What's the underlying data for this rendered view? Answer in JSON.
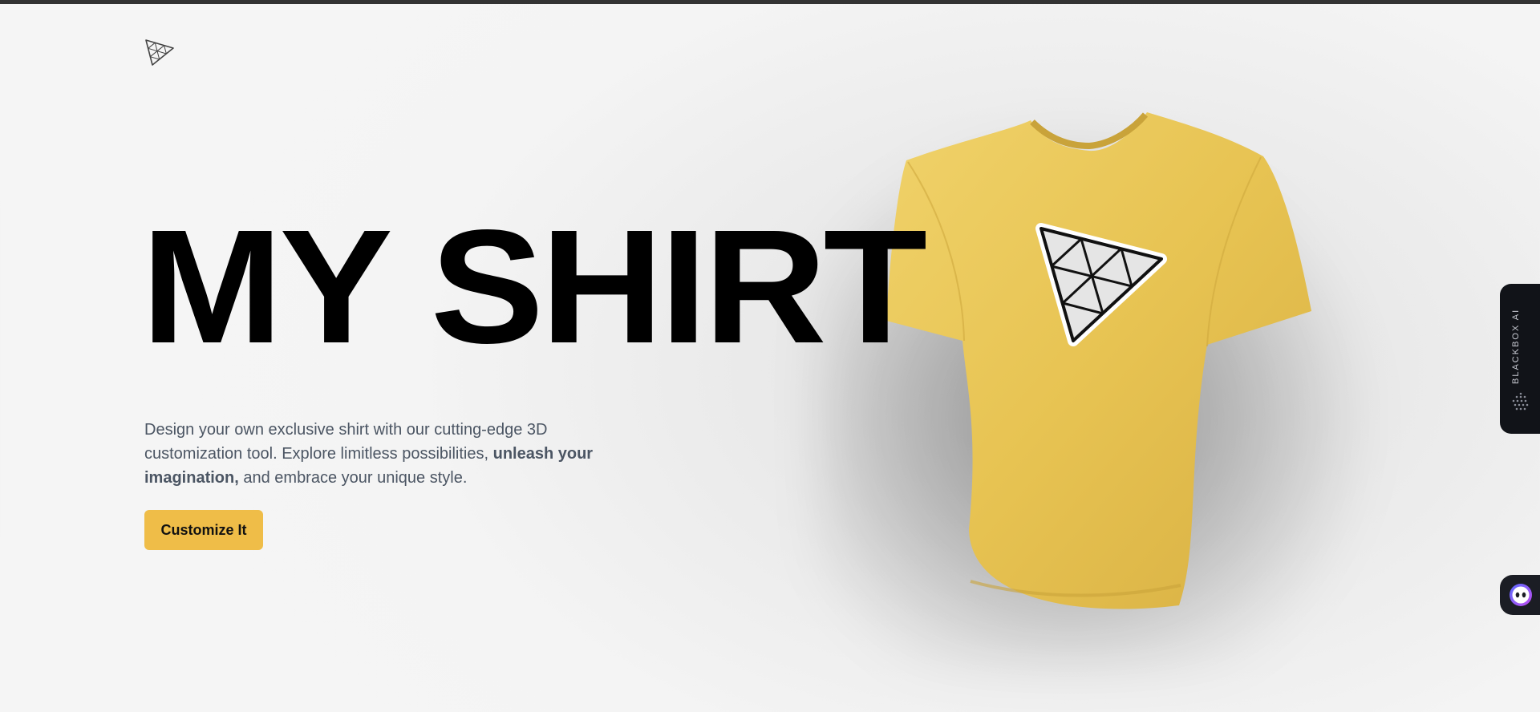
{
  "hero": {
    "title": "MY SHIRT",
    "tagline_part1": "Design your own exclusive shirt with our cutting-edge 3D customization tool. Explore limitless possibilities, ",
    "tagline_bold": "unleash your imagination,",
    "tagline_part2": " and embrace your unique style.",
    "cta_label": "Customize It"
  },
  "side_panel": {
    "label": "BLACKBOX AI"
  },
  "colors": {
    "accent": "#efbd48",
    "shirt": "#e8c452",
    "title": "#000000",
    "body_text": "#4b5563",
    "panel": "#111318"
  },
  "icons": {
    "logo": "triangle-logo-icon",
    "shirt_decal": "triangle-decal-icon",
    "panel": "dots-icon",
    "bot": "bot-face-icon"
  }
}
